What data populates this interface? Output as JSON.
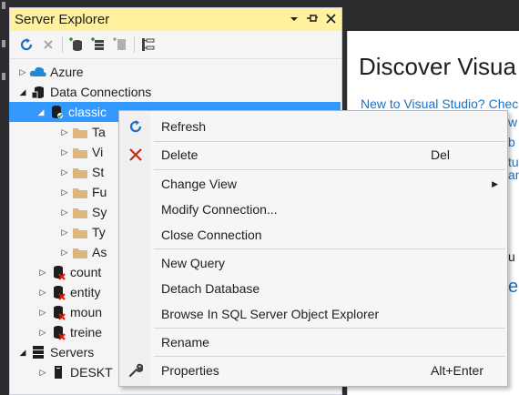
{
  "panel": {
    "title": "Server Explorer",
    "title_buttons": [
      "dropdown-icon",
      "pin-icon",
      "close-icon"
    ]
  },
  "toolbar": {
    "icons": [
      "refresh-icon",
      "stop-icon",
      "connect-database-icon",
      "connect-server-icon",
      "properties-icon",
      "tree-view-icon"
    ]
  },
  "tree": {
    "items": [
      {
        "label": "Azure",
        "expanded": false,
        "level": 0,
        "icon": "azure-icon"
      },
      {
        "label": "Data Connections",
        "expanded": true,
        "level": 0,
        "icon": "database-icon"
      },
      {
        "label": "classic",
        "expanded": true,
        "level": 1,
        "icon": "database-connected-icon",
        "selected": true
      },
      {
        "label": "Ta",
        "expanded": false,
        "level": 2,
        "icon": "folder-icon"
      },
      {
        "label": "Vi",
        "expanded": false,
        "level": 2,
        "icon": "folder-icon"
      },
      {
        "label": "St",
        "expanded": false,
        "level": 2,
        "icon": "folder-icon"
      },
      {
        "label": "Fu",
        "expanded": false,
        "level": 2,
        "icon": "folder-icon"
      },
      {
        "label": "Sy",
        "expanded": false,
        "level": 2,
        "icon": "folder-icon"
      },
      {
        "label": "Ty",
        "expanded": false,
        "level": 2,
        "icon": "folder-icon"
      },
      {
        "label": "As",
        "expanded": false,
        "level": 2,
        "icon": "folder-icon"
      },
      {
        "label": "count",
        "expanded": false,
        "level": 1,
        "icon": "database-error-icon"
      },
      {
        "label": "entity",
        "expanded": false,
        "level": 1,
        "icon": "database-error-icon"
      },
      {
        "label": "moun",
        "expanded": false,
        "level": 1,
        "icon": "database-error-icon"
      },
      {
        "label": "treine",
        "expanded": false,
        "level": 1,
        "icon": "database-error-icon"
      },
      {
        "label": "Servers",
        "expanded": true,
        "level": 0,
        "icon": "servers-icon"
      },
      {
        "label": "DESKT",
        "expanded": false,
        "level": 1,
        "icon": "server-icon"
      }
    ]
  },
  "document": {
    "heading": "Discover Visua",
    "link": "New to Visual Studio? Chec",
    "fragments": [
      "w",
      "b",
      "tu",
      "an",
      "u",
      "e"
    ]
  },
  "context_menu": {
    "items": [
      {
        "label": "Refresh",
        "shortcut": "",
        "icon": "refresh-icon"
      },
      {
        "label": "Delete",
        "shortcut": "Del",
        "icon": "delete-icon"
      },
      {
        "label": "Change View",
        "shortcut": "",
        "icon": "",
        "submenu": true
      },
      {
        "label": "Modify Connection...",
        "shortcut": "",
        "icon": ""
      },
      {
        "label": "Close Connection",
        "shortcut": "",
        "icon": ""
      },
      {
        "label": "New Query",
        "shortcut": "",
        "icon": ""
      },
      {
        "label": "Detach Database",
        "shortcut": "",
        "icon": ""
      },
      {
        "label": "Browse In SQL Server Object Explorer",
        "shortcut": "",
        "icon": ""
      },
      {
        "label": "Rename",
        "shortcut": "",
        "icon": ""
      },
      {
        "label": "Properties",
        "shortcut": "Alt+Enter",
        "icon": "wrench-icon"
      }
    ]
  },
  "colors": {
    "title_bar": "#fff19d",
    "selection": "#3399ff",
    "link": "#1e70c0",
    "delete_red": "#c42b1c",
    "refresh_blue": "#1e6fc8"
  }
}
